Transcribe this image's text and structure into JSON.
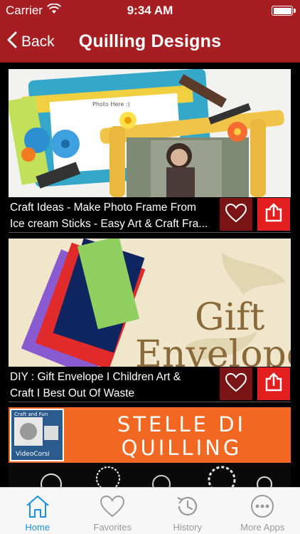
{
  "status_bar": {
    "carrier": "Carrier",
    "time": "9:34 AM",
    "icons": [
      "wifi-icon",
      "battery-icon"
    ]
  },
  "nav": {
    "back_label": "Back",
    "title": "Quilling Designs"
  },
  "feed": {
    "items": [
      {
        "caption_line1": "Craft Ideas - Make Photo Frame From",
        "caption_line2": "Ice cream Sticks - Easy Art & Craft Fra...",
        "thumb_overlay_text": "Photo Here :)"
      },
      {
        "caption_line1": "DIY : Gift Envelope  I Children Art &",
        "caption_line2": "Craft I Best Out Of Waste",
        "thumb_title_line1": "Gift",
        "thumb_title_line2": "Envelope"
      },
      {
        "banner_line1": "STELLE DI",
        "banner_line2": "QUILLING",
        "logo_top": "Craft and Fun",
        "logo_bottom": "VideoCorsi"
      }
    ]
  },
  "tabs": [
    {
      "label": "Home",
      "icon": "home-icon",
      "active": true
    },
    {
      "label": "Favorites",
      "icon": "heart-icon",
      "active": false
    },
    {
      "label": "History",
      "icon": "history-icon",
      "active": false
    },
    {
      "label": "More Apps",
      "icon": "more-icon",
      "active": false
    }
  ],
  "colors": {
    "brand_red": "#a61e22",
    "share_red": "#e31e1e",
    "fav_dark_red": "#7a1416",
    "tab_active": "#1a8fe6",
    "tab_inactive": "#9a9a9a",
    "banner_orange": "#f26722"
  }
}
